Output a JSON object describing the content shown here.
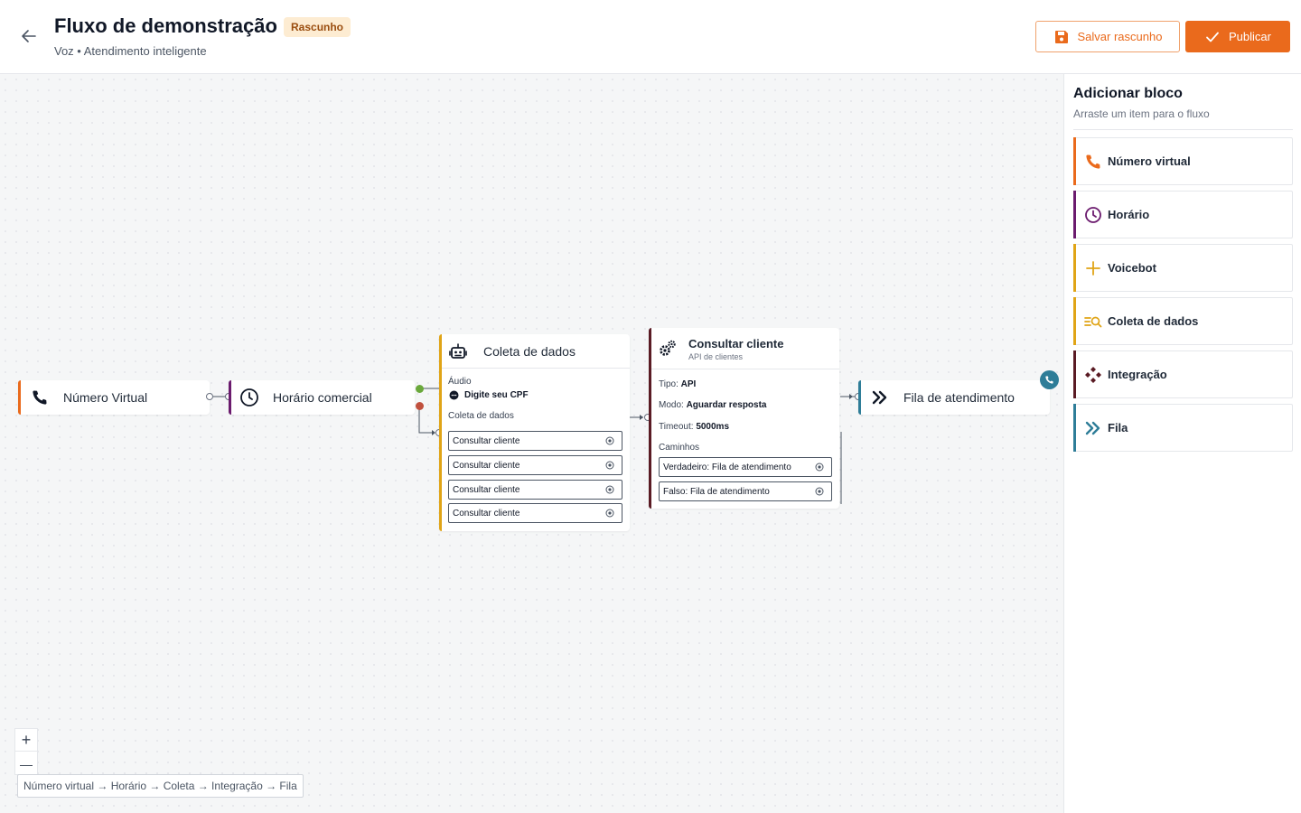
{
  "header": {
    "title": "Fluxo de demonstração",
    "badge": "Rascunho",
    "subtitle": "Voz • Atendimento inteligente",
    "save_draft_label": "Salvar rascunho",
    "publish_label": "Publicar"
  },
  "colors": {
    "accent": "#ea6a1c",
    "phone": "#ea6a1c",
    "schedule": "#6b1b6e",
    "collect": "#e0a416",
    "integration": "#5a1b24",
    "queue": "#2e7d98"
  },
  "canvas": {
    "nodes": {
      "virtual_number": {
        "label": "Número Virtual",
        "icon": "phone-icon"
      },
      "business_hours": {
        "label": "Horário comercial",
        "icon": "clock-icon"
      },
      "collect": {
        "title": "Coleta de dados",
        "icon": "robot-icon",
        "audio_label": "Áudio",
        "prompt": "Digite seu CPF",
        "section_label": "Coleta de dados",
        "rows": [
          "Consultar cliente",
          "Consultar cliente",
          "Consultar cliente",
          "Consultar cliente"
        ]
      },
      "integration": {
        "title": "Consultar cliente",
        "subtitle": "API de clientes",
        "icon": "gears-icon",
        "type_label": "Tipo:",
        "type_value": "API",
        "mode_label": "Modo:",
        "mode_value": "Aguardar resposta",
        "timeout_label": "Timeout:",
        "timeout_value": "5000ms",
        "paths_label": "Caminhos",
        "paths": [
          "Verdadeiro: Fila de atendimento",
          "Falso: Fila de atendimento"
        ]
      },
      "queue": {
        "label": "Fila de atendimento",
        "icon": "chevrons-right-icon"
      }
    },
    "zoom_in": "+",
    "zoom_out": "—",
    "path_summary": "Número virtual → Horário → Coleta → Integração → Fila"
  },
  "sidebar": {
    "title": "Adicionar bloco",
    "subtitle": "Arraste um item para o fluxo",
    "items": [
      {
        "label": "Número virtual",
        "icon": "phone-icon"
      },
      {
        "label": "Horário",
        "icon": "clock-icon"
      },
      {
        "label": "Voicebot",
        "icon": "plus-icon"
      },
      {
        "label": "Coleta de dados",
        "icon": "list-search-icon"
      },
      {
        "label": "Integração",
        "icon": "integration-icon"
      },
      {
        "label": "Fila",
        "icon": "chevrons-right-icon"
      }
    ]
  }
}
